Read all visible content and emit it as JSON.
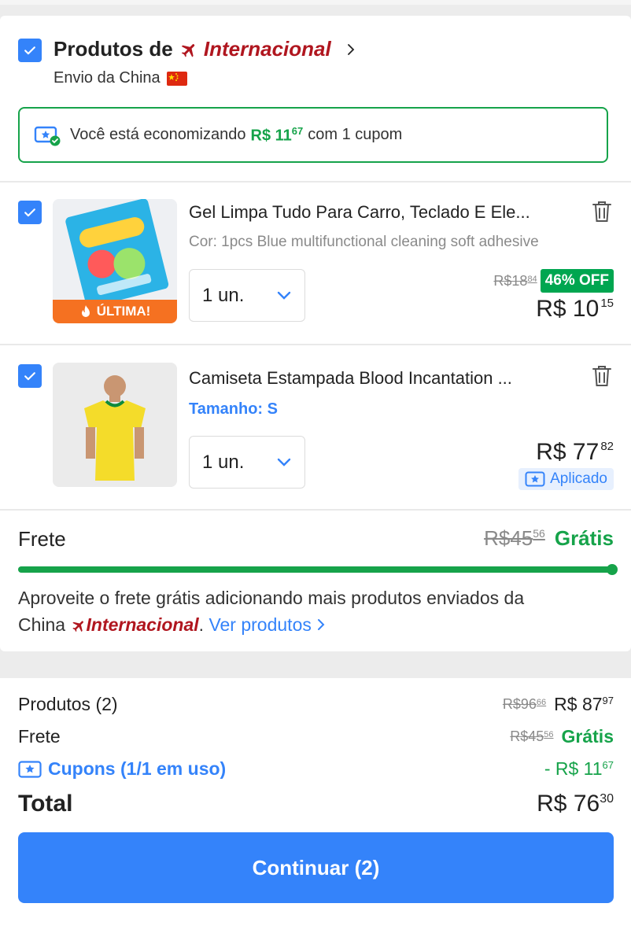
{
  "seller": {
    "prefix": "Produtos de",
    "brand": "Internacional",
    "shipping_origin": "Envio da China"
  },
  "savings": {
    "text_before": "Você está economizando",
    "amount_int": "R$ 11",
    "amount_cents": "67",
    "text_after": "com 1 cupom"
  },
  "items": [
    {
      "name": "Gel Limpa Tudo Para Carro, Teclado E Ele...",
      "variant": "Cor: 1pcs Blue multifunctional cleaning soft adhesive",
      "qty": "1 un.",
      "badge": "ÚLTIMA!",
      "old_price_int": "R$18",
      "old_price_cents": "84",
      "discount": "46% OFF",
      "price_int": "R$ 10",
      "price_cents": "15"
    },
    {
      "name": "Camiseta Estampada Blood Incantation ...",
      "variant": "Tamanho: S",
      "qty": "1 un.",
      "price_int": "R$ 77",
      "price_cents": "82",
      "applied_label": "Aplicado"
    }
  ],
  "shipping": {
    "label": "Frete",
    "old_int": "R$45",
    "old_cents": "56",
    "free": "Grátis",
    "progress": 1.0,
    "message_1": "Aproveite o frete grátis adicionando mais produtos enviados da",
    "message_2": "China",
    "brand": "Internacional",
    "link": "Ver produtos"
  },
  "summary": {
    "products_label": "Produtos (2)",
    "products_old_int": "R$96",
    "products_old_cents": "66",
    "products_int": "R$ 87",
    "products_cents": "97",
    "shipping_label": "Frete",
    "shipping_old_int": "R$45",
    "shipping_old_cents": "56",
    "shipping_free": "Grátis",
    "coupons_label": "Cupons (1/1 em uso)",
    "coupons_int": "- R$ 11",
    "coupons_cents": "67",
    "total_label": "Total",
    "total_int": "R$ 76",
    "total_cents": "30"
  },
  "cta": {
    "label": "Continuar (2)"
  },
  "colors": {
    "accent": "#3483fa",
    "green": "#16a34a",
    "brand_red": "#b0161f",
    "badge_orange": "#f57121"
  }
}
